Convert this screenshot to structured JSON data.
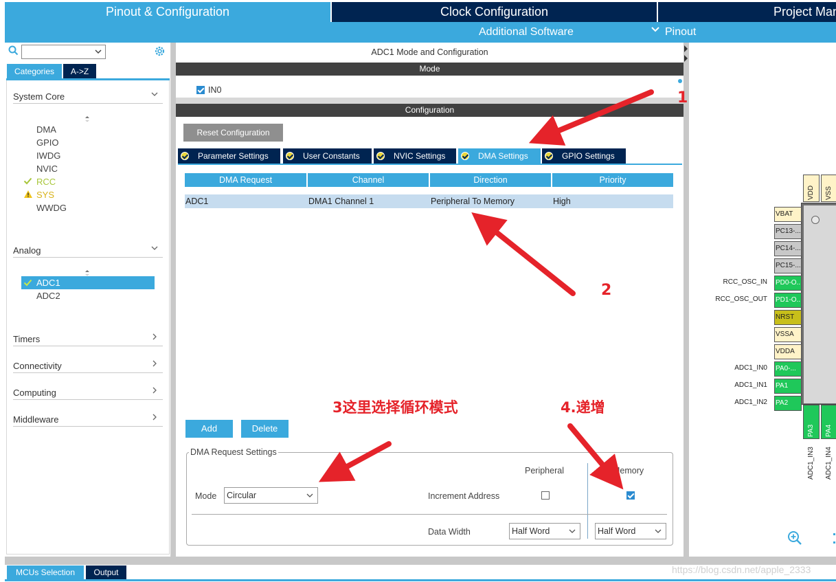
{
  "top_tabs": {
    "pinout": "Pinout & Configuration",
    "clock": "Clock Configuration",
    "project": "Project Man"
  },
  "subbar": {
    "additional": "Additional Software",
    "pinout": "Pinout",
    "pinout_chevron": "chevron-down-icon"
  },
  "left": {
    "search_value": "",
    "tabs": {
      "categories": "Categories",
      "az": "A->Z"
    },
    "system_core": {
      "label": "System Core",
      "items": [
        "DMA",
        "GPIO",
        "IWDG",
        "NVIC",
        "RCC",
        "SYS",
        "WWDG"
      ]
    },
    "analog": {
      "label": "Analog",
      "items": [
        "ADC1",
        "ADC2"
      ]
    },
    "timers": "Timers",
    "connectivity": "Connectivity",
    "computing": "Computing",
    "middleware": "Middleware"
  },
  "center": {
    "title": "ADC1 Mode and Configuration",
    "mode_bar": "Mode",
    "in0": "IN0",
    "config_bar": "Configuration",
    "reset": "Reset Configuration",
    "tabs": [
      "Parameter Settings",
      "User Constants",
      "NVIC Settings",
      "DMA Settings",
      "GPIO Settings"
    ],
    "table": {
      "headers": [
        "DMA Request",
        "Channel",
        "Direction",
        "Priority"
      ],
      "rows": [
        [
          "ADC1",
          "DMA1 Channel 1",
          "Peripheral To Memory",
          "High"
        ]
      ]
    },
    "add": "Add",
    "delete": "Delete",
    "settings": {
      "legend": "DMA Request Settings",
      "peripheral": "Peripheral",
      "memory": "Memory",
      "mode_label": "Mode",
      "mode_value": "Circular",
      "increment": "Increment Address",
      "data_width": "Data Width",
      "width_periph": "Half Word",
      "width_mem": "Half Word",
      "periph_increment": false,
      "mem_increment": true
    }
  },
  "annotations": {
    "a1": "1",
    "a2": "2",
    "a3": "3这里选择循环模式",
    "a4": "4.递增"
  },
  "right": {
    "top_pins": [
      "VDD",
      "VSS"
    ],
    "pins": [
      {
        "name": "VBAT",
        "label": "",
        "type": "cream"
      },
      {
        "name": "PC13-...",
        "label": "",
        "type": "gray"
      },
      {
        "name": "PC14-...",
        "label": "",
        "type": "gray"
      },
      {
        "name": "PC15-...",
        "label": "",
        "type": "gray"
      },
      {
        "name": "PD0-O...",
        "label": "RCC_OSC_IN",
        "type": "green"
      },
      {
        "name": "PD1-O...",
        "label": "RCC_OSC_OUT",
        "type": "green"
      },
      {
        "name": "NRST",
        "label": "",
        "type": "olive"
      },
      {
        "name": "VSSA",
        "label": "",
        "type": "cream"
      },
      {
        "name": "VDDA",
        "label": "",
        "type": "cream"
      },
      {
        "name": "PA0-...",
        "label": "ADC1_IN0",
        "type": "green"
      },
      {
        "name": "PA1",
        "label": "ADC1_IN1",
        "type": "green"
      },
      {
        "name": "PA2",
        "label": "ADC1_IN2",
        "type": "green"
      }
    ],
    "bottom_pins": [
      "PA3",
      "PA4"
    ],
    "bottom_labels": [
      "ADC1_IN3",
      "ADC1_IN4"
    ]
  },
  "bottom": {
    "mcus": "MCUs Selection",
    "output": "Output"
  },
  "watermark": "https://blog.csdn.net/apple_2333",
  "colors": {
    "navy": "#002451",
    "blue": "#3ba9dd",
    "red": "#e5232a",
    "green_pin": "#1fc85a"
  }
}
